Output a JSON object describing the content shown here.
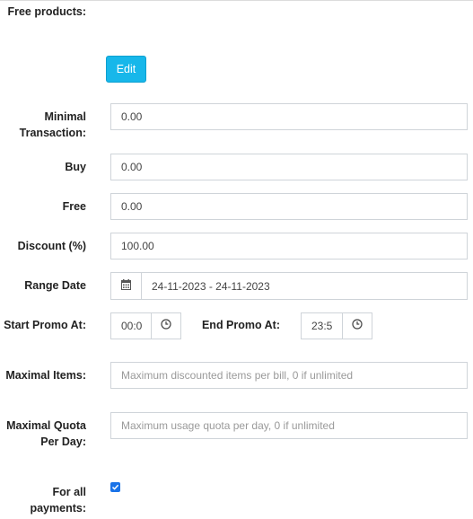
{
  "free_products": {
    "label": "Free products:",
    "edit_label": "Edit"
  },
  "minimal_transaction": {
    "label": "Minimal Transaction:",
    "value": "0.00"
  },
  "buy": {
    "label": "Buy",
    "value": "0.00"
  },
  "free": {
    "label": "Free",
    "value": "0.00"
  },
  "discount": {
    "label": "Discount (%)",
    "value": "100.00"
  },
  "range_date": {
    "label": "Range Date",
    "value": "24-11-2023 - 24-11-2023"
  },
  "start_promo": {
    "label": "Start Promo At:",
    "value": "00:0"
  },
  "end_promo": {
    "label": "End Promo At:",
    "value": "23:5"
  },
  "maximal_items": {
    "label": "Maximal Items:",
    "placeholder": "Maximum discounted items per bill, 0 if unlimited"
  },
  "maximal_quota": {
    "label": "Maximal Quota Per Day:",
    "placeholder": "Maximum usage quota per day, 0 if unlimited"
  },
  "for_all_payments": {
    "label": "For all payments:",
    "checked": true
  },
  "colors": {
    "accent": "#17b7ea",
    "checkbox": "#1a73e8",
    "border": "#cfd4d9"
  },
  "icons": {
    "calendar": "calendar-icon",
    "clock": "clock-icon",
    "check": "check-icon"
  }
}
